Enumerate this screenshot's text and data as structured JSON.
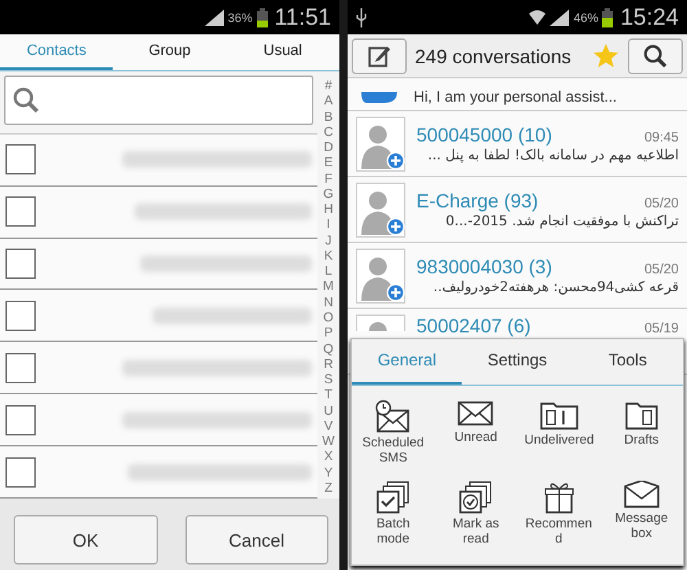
{
  "left_screen": {
    "status_bar": {
      "battery": "36%",
      "time": "11:51"
    },
    "tabs": [
      {
        "label": "Contacts",
        "selected": true
      },
      {
        "label": "Group",
        "selected": false
      },
      {
        "label": "Usual",
        "selected": false
      }
    ],
    "contacts": [
      {
        "checked": false
      },
      {
        "checked": false
      },
      {
        "checked": false
      },
      {
        "checked": false
      },
      {
        "checked": false
      },
      {
        "checked": false
      },
      {
        "checked": false
      }
    ],
    "index_letters": [
      "#",
      "A",
      "B",
      "C",
      "D",
      "E",
      "F",
      "G",
      "H",
      "I",
      "J",
      "K",
      "L",
      "M",
      "N",
      "O",
      "P",
      "Q",
      "R",
      "S",
      "T",
      "U",
      "V",
      "W",
      "X",
      "Y",
      "Z"
    ],
    "buttons": [
      "OK",
      "Cancel"
    ]
  },
  "right_screen": {
    "status_bar": {
      "battery": "46%",
      "time": "15:24"
    },
    "toolbar": {
      "title": "249 conversations"
    },
    "conversations": [
      {
        "kind": "partial",
        "preview": "Hi, I am your personal assist..."
      },
      {
        "kind": "full",
        "name": "500045000 (10)",
        "preview": "اطلاعیه مهم در سامانه بالک! لطفا به پنل ...",
        "time": "09:45"
      },
      {
        "kind": "full",
        "name": "E-Charge (93)",
        "preview": "تراکنش با موفقیت انجام شد. 2015-...0",
        "time": "05/20"
      },
      {
        "kind": "full",
        "name": "9830004030 (3)",
        "preview": "قرعه کشی94محسن: هرهفته2خودرولیف..",
        "time": "05/20"
      },
      {
        "kind": "covered",
        "name": "50002407 (6)",
        "time": "05/19"
      }
    ],
    "menu": {
      "tabs": [
        {
          "label": "General",
          "selected": true
        },
        {
          "label": "Settings",
          "selected": false
        },
        {
          "label": "Tools",
          "selected": false
        }
      ],
      "items": [
        {
          "kind": "scheduled",
          "label": "Scheduled SMS"
        },
        {
          "kind": "unread",
          "label": "Unread"
        },
        {
          "kind": "undelivered",
          "label": "Undelivered"
        },
        {
          "kind": "drafts",
          "label": "Drafts"
        },
        {
          "kind": "batch",
          "label": "Batch mode"
        },
        {
          "kind": "markread",
          "label": "Mark as read"
        },
        {
          "kind": "gift",
          "label": "Recommen d"
        },
        {
          "kind": "box",
          "label": "Message box"
        }
      ]
    }
  }
}
